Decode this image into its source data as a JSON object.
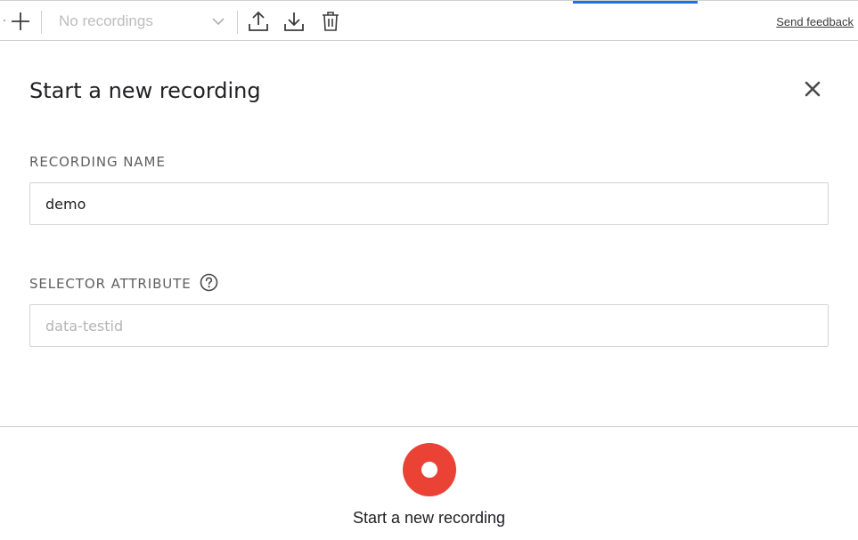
{
  "toolbar": {
    "add_icon": "plus-icon",
    "recording_select": {
      "selected_label": "No recordings",
      "icon": "chevron-down-icon"
    },
    "actions": [
      {
        "name": "export",
        "icon": "upload-icon"
      },
      {
        "name": "import",
        "icon": "download-icon"
      },
      {
        "name": "delete",
        "icon": "trash-icon"
      }
    ],
    "send_feedback_label": "Send feedback"
  },
  "dialog": {
    "title": "Start a new recording",
    "close_icon": "close-icon",
    "recording_name": {
      "label": "RECORDING NAME",
      "value": "demo"
    },
    "selector_attribute": {
      "label": "SELECTOR ATTRIBUTE",
      "help_icon": "help-icon",
      "value": "",
      "placeholder": "data-testid"
    }
  },
  "footer": {
    "record_button_icon": "record-icon",
    "record_button_label": "Start a new recording"
  },
  "colors": {
    "record_red": "#ea4335",
    "active_tab_blue": "#1a73e8",
    "placeholder_gray": "#b5b5b5"
  }
}
